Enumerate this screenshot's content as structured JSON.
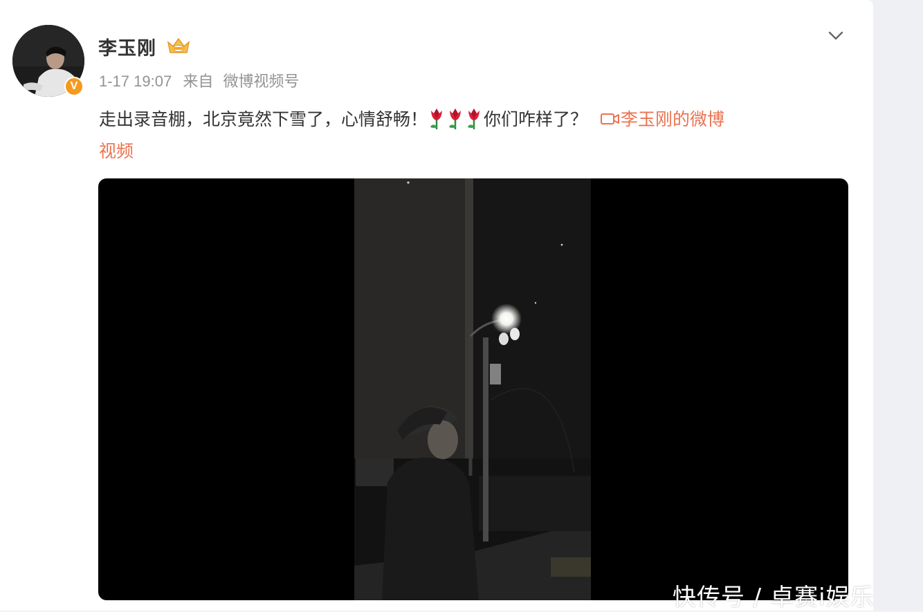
{
  "post": {
    "author": {
      "name": "李玉刚",
      "verified": true,
      "avatar": "avatar"
    },
    "meta": {
      "time": "1-17 19:07",
      "source_prefix": "来自",
      "source": "微博视频号"
    },
    "text": {
      "part1": "走出录音棚，北京竟然下雪了，心情舒畅！",
      "emoji": "red-tulip",
      "part2": "你们咋样了？",
      "link_line1": "李玉刚的微博",
      "link_line2": "视频"
    },
    "video": {
      "description": "video-thumbnail"
    }
  },
  "watermark": "快传号 / 卓赛i娱乐",
  "colors": {
    "link": "#eb7350",
    "verified": "#f39a1f",
    "meta": "#939393",
    "text": "#333333"
  }
}
